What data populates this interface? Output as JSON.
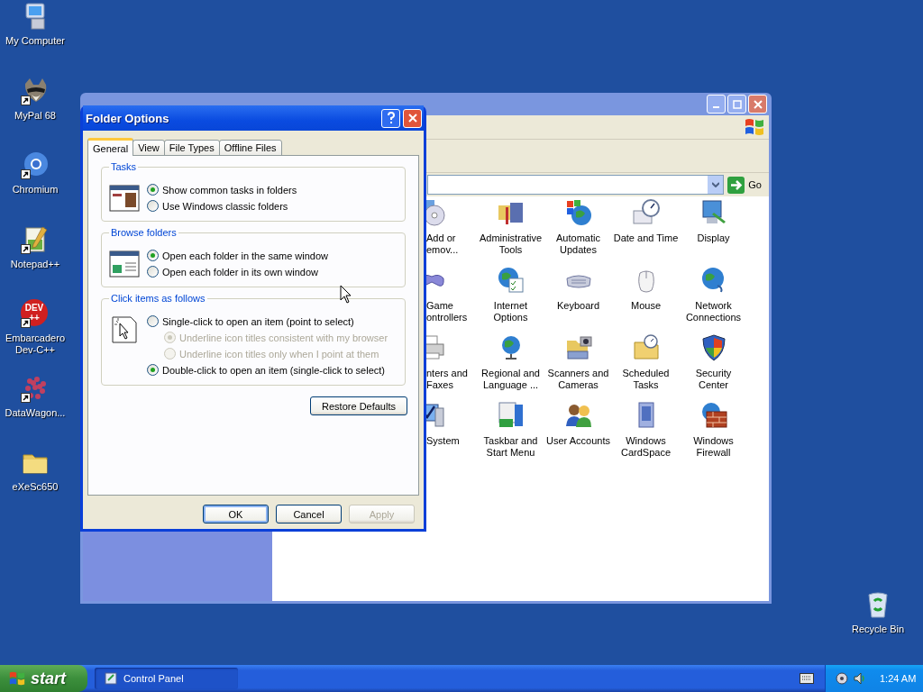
{
  "desktop_icons": [
    {
      "label": "My Computer"
    },
    {
      "label": "MyPal 68",
      "shortcut": true
    },
    {
      "label": "Chromium",
      "shortcut": true
    },
    {
      "label": "Notepad++",
      "shortcut": true
    },
    {
      "label": "Embarcadero\nDev-C++",
      "shortcut": true,
      "icon_text": [
        "DEV",
        "++"
      ]
    },
    {
      "label": "DataWagon...",
      "shortcut": true
    },
    {
      "label": "eXeSc650"
    }
  ],
  "recycle_bin": {
    "label": "Recycle Bin"
  },
  "control_panel": {
    "go_label": "Go",
    "items": [
      {
        "label": "Add or\nemov..."
      },
      {
        "label": "Administrative\nTools"
      },
      {
        "label": "Automatic\nUpdates"
      },
      {
        "label": "Date and Time"
      },
      {
        "label": "Display"
      },
      {
        "label": "Game\nontrollers"
      },
      {
        "label": "Internet\nOptions"
      },
      {
        "label": "Keyboard"
      },
      {
        "label": "Mouse"
      },
      {
        "label": "Network\nConnections"
      },
      {
        "label": "nters and\nFaxes"
      },
      {
        "label": "Regional and\nLanguage ..."
      },
      {
        "label": "Scanners and\nCameras"
      },
      {
        "label": "Scheduled\nTasks"
      },
      {
        "label": "Security\nCenter"
      },
      {
        "label": "System"
      },
      {
        "label": "Taskbar and\nStart Menu"
      },
      {
        "label": "User Accounts"
      },
      {
        "label": "Windows\nCardSpace"
      },
      {
        "label": "Windows\nFirewall"
      }
    ]
  },
  "folder_options": {
    "title": "Folder Options",
    "tabs": [
      {
        "label": "General",
        "selected": true
      },
      {
        "label": "View",
        "selected": false
      },
      {
        "label": "File Types",
        "selected": false
      },
      {
        "label": "Offline Files",
        "selected": false
      }
    ],
    "groups": [
      {
        "title": "Tasks",
        "options": [
          {
            "label": "Show common tasks in folders",
            "selected": true,
            "disabled": false
          },
          {
            "label": "Use Windows classic folders",
            "selected": false,
            "disabled": false
          }
        ]
      },
      {
        "title": "Browse folders",
        "options": [
          {
            "label": "Open each folder in the same window",
            "selected": true,
            "disabled": false
          },
          {
            "label": "Open each folder in its own window",
            "selected": false,
            "disabled": false
          }
        ]
      },
      {
        "title": "Click items as follows",
        "options": [
          {
            "label": "Single-click to open an item (point to select)",
            "selected": false,
            "disabled": false,
            "children": [
              {
                "label": "Underline icon titles consistent with my browser",
                "selected": true,
                "disabled": true
              },
              {
                "label": "Underline icon titles only when I point at them",
                "selected": false,
                "disabled": true
              }
            ]
          },
          {
            "label": "Double-click to open an item (single-click to select)",
            "selected": true,
            "disabled": false
          }
        ]
      }
    ],
    "restore_label": "Restore Defaults",
    "buttons": [
      {
        "label": "OK",
        "default": true,
        "disabled": false
      },
      {
        "label": "Cancel",
        "default": false,
        "disabled": false
      },
      {
        "label": "Apply",
        "default": false,
        "disabled": true
      }
    ]
  },
  "taskbar": {
    "start_label": "start",
    "tasks": [
      {
        "label": "Control Panel"
      }
    ],
    "clock": "1:24 AM"
  }
}
